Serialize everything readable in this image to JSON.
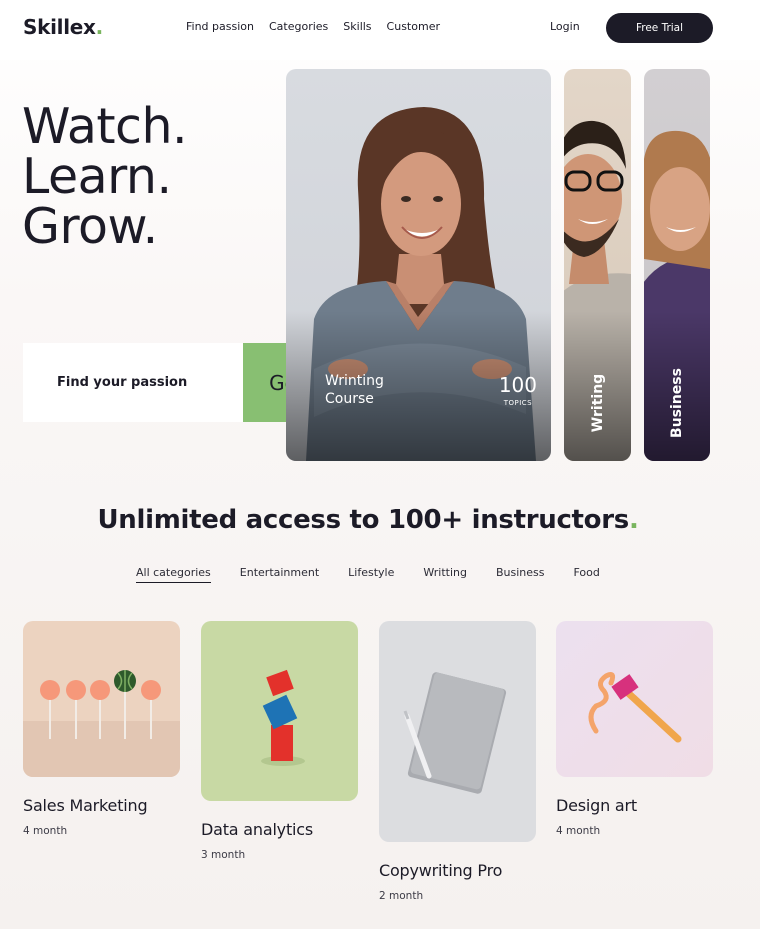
{
  "brand": {
    "name": "Skillex",
    "dot": "."
  },
  "nav": {
    "links": [
      "Find passion",
      "Categories",
      "Skills",
      "Customer"
    ],
    "login": "Login",
    "trial": "Free Trial"
  },
  "hero": {
    "line1": "Watch.",
    "line2": "Learn.",
    "line3": "Grow.",
    "search_placeholder": "Find your passion",
    "go": "Go"
  },
  "featured": {
    "main": {
      "title_line1": "Wrinting",
      "title_line2": "Course",
      "number": "100",
      "number_label": "TOPICS"
    },
    "side": [
      "Writing",
      "Business"
    ]
  },
  "section": {
    "title": "Unlimited access to 100+ instructors",
    "dot": "."
  },
  "categories": [
    "All categories",
    "Entertainment",
    "Lifestyle",
    "Writting",
    "Business",
    "Food"
  ],
  "courses": [
    {
      "name": "Sales Marketing",
      "duration": "4 month"
    },
    {
      "name": "Data analytics",
      "duration": "3 month"
    },
    {
      "name": "Copywriting Pro",
      "duration": "2 month"
    },
    {
      "name": "Design art",
      "duration": "4 month"
    }
  ],
  "colors": {
    "accent": "#88bf72",
    "dark": "#1c1b27"
  }
}
